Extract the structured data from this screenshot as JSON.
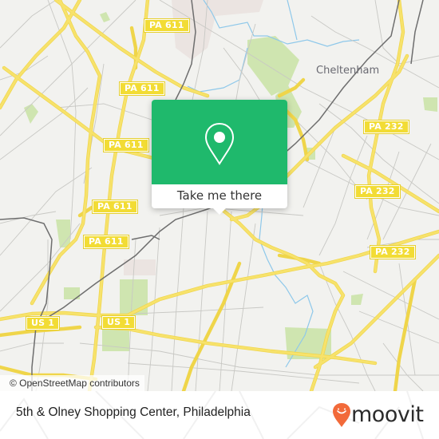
{
  "map": {
    "shields": [
      {
        "id": "pa611-a",
        "label": "PA 611"
      },
      {
        "id": "pa611-b",
        "label": "PA 611"
      },
      {
        "id": "pa611-c",
        "label": "PA 611"
      },
      {
        "id": "pa611-d",
        "label": "PA 611"
      },
      {
        "id": "pa611-e",
        "label": "PA 611"
      },
      {
        "id": "pa232-a",
        "label": "PA 232"
      },
      {
        "id": "pa232-b",
        "label": "PA 232"
      },
      {
        "id": "pa232-c",
        "label": "PA 232"
      },
      {
        "id": "us1-a",
        "label": "US 1"
      },
      {
        "id": "us1-b",
        "label": "US 1"
      }
    ],
    "place_labels": [
      {
        "id": "cheltenham",
        "label": "Cheltenham"
      }
    ],
    "attribution": "© OpenStreetMap contributors",
    "colors": {
      "background": "#f2f2ef",
      "major_road": "#f7e26b",
      "minor_road": "#c8c8c4",
      "rail": "#6e6e6e",
      "park": "#cfe5b0",
      "water": "#8ec8ea"
    }
  },
  "popup": {
    "icon": "map-pin-icon",
    "button_label": "Take me there",
    "accent_color": "#1fb96c"
  },
  "footer": {
    "location_title": "5th & Olney Shopping Center, Philadelphia",
    "logo_text": "moovit",
    "logo_icon": "moovit-smile-pin-icon",
    "logo_color": "#f26a3a"
  }
}
